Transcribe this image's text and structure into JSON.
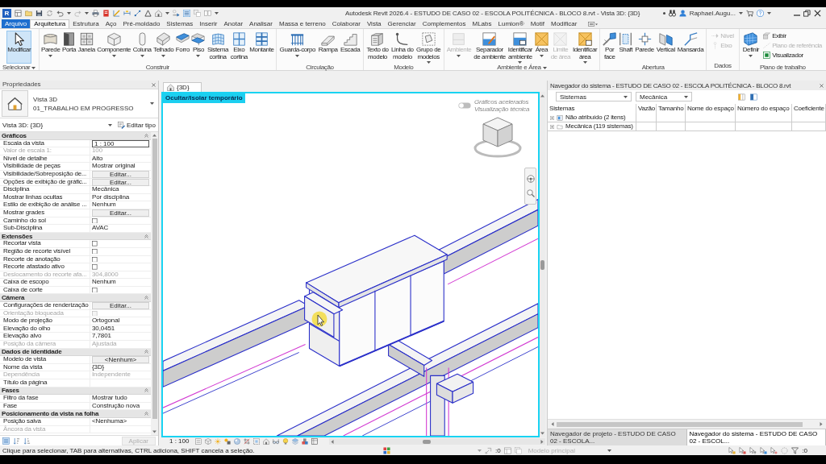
{
  "window": {
    "logo": "R",
    "title": "Autodesk Revit 2026.4 - ESTUDO DE CASO 02 - ESCOLA POLITÉCNICA - BLOCO 8.rvt - Vista 3D: {3D}",
    "user": "Raphael.Augu..."
  },
  "ribbon_tabs": [
    {
      "label": "Arquivo",
      "kind": "file",
      "selected": false
    },
    {
      "label": "Arquitetura",
      "kind": "tab",
      "selected": true
    },
    {
      "label": "Estrutura",
      "kind": "tab",
      "selected": false
    },
    {
      "label": "Aço",
      "kind": "tab",
      "selected": false
    },
    {
      "label": "Pré-moldado",
      "kind": "tab",
      "selected": false
    },
    {
      "label": "Sistemas",
      "kind": "tab",
      "selected": false
    },
    {
      "label": "Inserir",
      "kind": "tab",
      "selected": false
    },
    {
      "label": "Anotar",
      "kind": "tab",
      "selected": false
    },
    {
      "label": "Analisar",
      "kind": "tab",
      "selected": false
    },
    {
      "label": "Massa e terreno",
      "kind": "tab",
      "selected": false
    },
    {
      "label": "Colaborar",
      "kind": "tab",
      "selected": false
    },
    {
      "label": "Vista",
      "kind": "tab",
      "selected": false
    },
    {
      "label": "Gerenciar",
      "kind": "tab",
      "selected": false
    },
    {
      "label": "Complementos",
      "kind": "tab",
      "selected": false
    },
    {
      "label": "MLabs",
      "kind": "tab",
      "selected": false
    },
    {
      "label": "Lumion®",
      "kind": "tab",
      "selected": false
    },
    {
      "label": "Motif",
      "kind": "tab",
      "selected": false
    },
    {
      "label": "Modificar",
      "kind": "tab",
      "selected": false
    }
  ],
  "ribbon_panels": [
    {
      "title": "Selecionar",
      "menu": true,
      "buttons": [
        {
          "label": "Modificar",
          "kind": "large",
          "dropdown": false,
          "disabled": false,
          "selected": true
        }
      ]
    },
    {
      "title": "Construir",
      "menu": false,
      "buttons": [
        {
          "label": "Parede",
          "kind": "large",
          "dropdown": true,
          "disabled": false,
          "selected": false
        },
        {
          "label": "Porta",
          "kind": "large",
          "dropdown": false,
          "disabled": false,
          "selected": false
        },
        {
          "label": "Janela",
          "kind": "large",
          "dropdown": false,
          "disabled": false,
          "selected": false
        },
        {
          "label": "Componente",
          "kind": "large",
          "dropdown": true,
          "disabled": false,
          "selected": false
        },
        {
          "label": "Coluna",
          "kind": "large",
          "dropdown": true,
          "disabled": false,
          "selected": false
        },
        {
          "label": "Telhado",
          "kind": "large",
          "dropdown": true,
          "disabled": false,
          "selected": false
        },
        {
          "label": "Forro",
          "kind": "large",
          "dropdown": false,
          "disabled": false,
          "selected": false
        },
        {
          "label": "Piso",
          "kind": "large",
          "dropdown": true,
          "disabled": false,
          "selected": false
        },
        {
          "label": "Sistema cortina",
          "kind": "large",
          "dropdown": false,
          "disabled": false,
          "selected": false
        },
        {
          "label": "Eixo cortina",
          "kind": "large",
          "dropdown": false,
          "disabled": false,
          "selected": false
        },
        {
          "label": "Montante",
          "kind": "large",
          "dropdown": false,
          "disabled": false,
          "selected": false
        }
      ]
    },
    {
      "title": "Circulação",
      "menu": false,
      "buttons": [
        {
          "label": "Guarda-corpo",
          "kind": "large",
          "dropdown": true,
          "disabled": false,
          "selected": false
        },
        {
          "label": "Rampa",
          "kind": "large",
          "dropdown": false,
          "disabled": false,
          "selected": false
        },
        {
          "label": "Escada",
          "kind": "large",
          "dropdown": false,
          "disabled": false,
          "selected": false
        }
      ]
    },
    {
      "title": "Modelo",
      "menu": false,
      "buttons": [
        {
          "label": "Texto do modelo",
          "kind": "large",
          "dropdown": false,
          "disabled": false,
          "selected": false
        },
        {
          "label": "Linha do modelo",
          "kind": "large",
          "dropdown": false,
          "disabled": false,
          "selected": false
        },
        {
          "label": "Grupo de modelos",
          "kind": "large",
          "dropdown": true,
          "disabled": false,
          "selected": false
        }
      ]
    },
    {
      "title": "Ambiente e Área",
      "menu": true,
      "buttons": [
        {
          "label": "Ambiente",
          "kind": "large",
          "dropdown": true,
          "disabled": true,
          "selected": false
        },
        {
          "label": "Separador de ambiente",
          "kind": "large",
          "dropdown": false,
          "disabled": false,
          "selected": false
        },
        {
          "label": "Identificar ambiente",
          "kind": "large",
          "dropdown": true,
          "disabled": false,
          "selected": false
        },
        {
          "label": "Área",
          "kind": "large",
          "dropdown": true,
          "disabled": false,
          "selected": false
        },
        {
          "label": "Limite de área",
          "kind": "large",
          "dropdown": false,
          "disabled": true,
          "selected": false
        },
        {
          "label": "Identificar área",
          "kind": "large",
          "dropdown": true,
          "disabled": false,
          "selected": false
        }
      ]
    },
    {
      "title": "Abertura",
      "menu": false,
      "buttons": [
        {
          "label": "Por face",
          "kind": "large",
          "dropdown": false,
          "disabled": false,
          "selected": false
        },
        {
          "label": "Shaft",
          "kind": "large",
          "dropdown": false,
          "disabled": false,
          "selected": false
        },
        {
          "label": "Parede",
          "kind": "large",
          "dropdown": false,
          "disabled": false,
          "selected": false
        },
        {
          "label": "Vertical",
          "kind": "large",
          "dropdown": false,
          "disabled": false,
          "selected": false
        },
        {
          "label": "Mansarda",
          "kind": "large",
          "dropdown": false,
          "disabled": false,
          "selected": false
        }
      ]
    },
    {
      "title": "Dados",
      "menu": false,
      "buttons": [
        {
          "label": "Nível",
          "kind": "small",
          "dropdown": false,
          "disabled": true,
          "selected": false
        },
        {
          "label": "Eixo",
          "kind": "small",
          "dropdown": false,
          "disabled": true,
          "selected": false
        }
      ]
    },
    {
      "title": "Plano de trabalho",
      "menu": false,
      "buttons": [
        {
          "label": "Definir",
          "kind": "large",
          "dropdown": true,
          "disabled": false,
          "selected": false
        },
        {
          "label": "Exibir",
          "kind": "small",
          "dropdown": false,
          "disabled": false,
          "selected": false
        },
        {
          "label": "Plano de referência",
          "kind": "small",
          "dropdown": false,
          "disabled": true,
          "selected": false
        },
        {
          "label": "Visualizador",
          "kind": "small",
          "dropdown": false,
          "disabled": false,
          "selected": false
        }
      ]
    }
  ],
  "properties": {
    "title": "Propriedades",
    "family": "Vista 3D",
    "type": "01_TRABALHO EM PROGRESSO",
    "instance": "Vista 3D: {3D}",
    "edit_type": "Editar tipo",
    "groups": [
      {
        "title": "Gráficos",
        "expanded": true,
        "rows": [
          {
            "label": "Escala da vista",
            "kind": "field",
            "value": "1 : 100",
            "disabled": false
          },
          {
            "label": "Valor de escala 1:",
            "kind": "text",
            "value": "100",
            "disabled": true
          },
          {
            "label": "Nível de detalhe",
            "kind": "text",
            "value": "Alto",
            "disabled": false
          },
          {
            "label": "Visibilidade de peças",
            "kind": "text",
            "value": "Mostrar original",
            "disabled": false
          },
          {
            "label": "Visibilidade/Sobreposição de...",
            "kind": "button",
            "value": "Editar...",
            "disabled": false
          },
          {
            "label": "Opções de exibição de gráfic...",
            "kind": "button",
            "value": "Editar...",
            "disabled": false
          },
          {
            "label": "Disciplina",
            "kind": "text",
            "value": "Mecânica",
            "disabled": false
          },
          {
            "label": "Mostrar linhas ocultas",
            "kind": "text",
            "value": "Por disciplina",
            "disabled": false
          },
          {
            "label": "Estilo de exibição de análise ...",
            "kind": "text",
            "value": "Nenhum",
            "disabled": false
          },
          {
            "label": "Mostrar grades",
            "kind": "button",
            "value": "Editar...",
            "disabled": false
          },
          {
            "label": "Caminho do sol",
            "kind": "checkbox",
            "checked": false,
            "disabled": false
          },
          {
            "label": "Sub-Disciplina",
            "kind": "text",
            "value": "AVAC",
            "disabled": false
          }
        ]
      },
      {
        "title": "Extensões",
        "expanded": true,
        "rows": [
          {
            "label": "Recortar vista",
            "kind": "checkbox",
            "checked": false,
            "disabled": false
          },
          {
            "label": "Região de recorte visível",
            "kind": "checkbox",
            "checked": false,
            "disabled": false
          },
          {
            "label": "Recorte de anotação",
            "kind": "checkbox",
            "checked": false,
            "disabled": false
          },
          {
            "label": "Recorte afastado ativo",
            "kind": "checkbox",
            "checked": false,
            "disabled": false
          },
          {
            "label": "Deslocamento do recorte afa...",
            "kind": "text",
            "value": "304,8000",
            "disabled": true
          },
          {
            "label": "Caixa de escopo",
            "kind": "text",
            "value": "Nenhum",
            "disabled": false
          },
          {
            "label": "Caixa de corte",
            "kind": "checkbox",
            "checked": false,
            "disabled": false
          }
        ]
      },
      {
        "title": "Câmera",
        "expanded": true,
        "rows": [
          {
            "label": "Configurações de renderização",
            "kind": "button",
            "value": "Editar...",
            "disabled": false
          },
          {
            "label": "Orientação bloqueada",
            "kind": "checkbox",
            "checked": false,
            "disabled": true
          },
          {
            "label": "Modo de projeção",
            "kind": "text",
            "value": "Ortogonal",
            "disabled": false
          },
          {
            "label": "Elevação do olho",
            "kind": "text",
            "value": "30,0451",
            "disabled": false
          },
          {
            "label": "Elevação alvo",
            "kind": "text",
            "value": "7,7801",
            "disabled": false
          },
          {
            "label": "Posição da câmera",
            "kind": "text",
            "value": "Ajustada",
            "disabled": true
          }
        ]
      },
      {
        "title": "Dados de identidade",
        "expanded": true,
        "rows": [
          {
            "label": "Modelo de vista",
            "kind": "button",
            "value": "<Nenhum>",
            "disabled": false
          },
          {
            "label": "Nome da vista",
            "kind": "text",
            "value": "{3D}",
            "disabled": false
          },
          {
            "label": "Dependência",
            "kind": "text",
            "value": "Independente",
            "disabled": true
          },
          {
            "label": "Título da página",
            "kind": "text",
            "disabled": false
          }
        ]
      },
      {
        "title": "Fases",
        "expanded": true,
        "rows": [
          {
            "label": "Filtro da fase",
            "kind": "text",
            "value": "Mostrar tudo",
            "disabled": false
          },
          {
            "label": "Fase",
            "kind": "text",
            "value": "Construção nova",
            "disabled": false
          }
        ]
      },
      {
        "title": "Posicionamento da vista na folha",
        "expanded": true,
        "rows": [
          {
            "label": "Posição salva",
            "kind": "text",
            "value": "<Nenhuma>",
            "disabled": false
          },
          {
            "label": "Âncora da vista",
            "kind": "text",
            "disabled": true
          }
        ]
      }
    ],
    "apply": {
      "label": "Aplicar",
      "disabled": true
    }
  },
  "view": {
    "tab": "{3D}",
    "isolate_label": "Ocultar/Isolar temporário",
    "graphics_toggle": {
      "on": false,
      "label": "Gráficos acelerados",
      "mode": "Visualização técnica"
    },
    "scale": "1 : 100"
  },
  "system_browser": {
    "title": "Navegador do sistema - ESTUDO DE CASO 02 - ESCOLA POLITÉCNICA - BLOCO 8.rvt",
    "view_filter": "Sistemas",
    "discipline": "Mecânica",
    "columns": [
      "Sistemas",
      "Vazão",
      "Tamanho",
      "Nome do espaço",
      "Número do espaço",
      "Coeficiente"
    ],
    "rows": [
      {
        "label": "Não atribuído (2 itens)",
        "kind": "unassigned",
        "expanded": false
      },
      {
        "label": "Mecânica (119 sistemas)",
        "kind": "folder",
        "expanded": false
      }
    ]
  },
  "browser_tabs": [
    {
      "label": "Navegador de projeto - ESTUDO DE CASO 02 - ESCOLA...",
      "selected": false
    },
    {
      "label": "Navegador do sistema - ESTUDO DE CASO 02 - ESCOL...",
      "selected": true
    }
  ],
  "status_bar": {
    "message": "Clique para selecionar, TAB para alternativas, CTRL adiciona, SHIFT cancela a seleção.",
    "link_count": ":0",
    "design_option": {
      "label": "Modelo principal",
      "disabled": true
    },
    "filter_count": ":0"
  }
}
